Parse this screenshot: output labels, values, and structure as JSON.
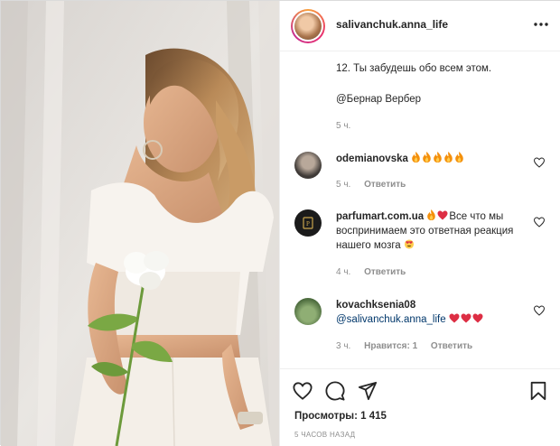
{
  "post": {
    "username": "salivanchuk.anna_life",
    "more_label": "···"
  },
  "caption": {
    "line1": "12. Ты забудешь обо всем этом.",
    "line2": "@Бернар Вербер",
    "time": "5 ч."
  },
  "comments": [
    {
      "username": "odemianovska",
      "text": "",
      "emoji": [
        "fire",
        "fire",
        "fire",
        "fire",
        "fire"
      ],
      "time": "5 ч.",
      "reply": "Ответить"
    },
    {
      "username": "parfumart.com.ua",
      "text_before": "",
      "emoji_inline": [
        "fire",
        "heart"
      ],
      "text": "Все что мы воспринимаем это ответная реакция нашего мозга",
      "emoji_end": "heart-eyes",
      "time": "4 ч.",
      "reply": "Ответить"
    },
    {
      "username": "kovachksenia08",
      "mention": "@salivanchuk.anna_life",
      "emoji": [
        "heart",
        "heart",
        "heart"
      ],
      "time": "3 ч.",
      "likes": "Нравится: 1",
      "reply": "Ответить"
    }
  ],
  "footer": {
    "views": "Просмотры: 1 415",
    "time_ago": "5 часов назад"
  },
  "icons": {
    "like": "heart-outline-icon",
    "comment": "comment-icon",
    "share": "share-icon",
    "save": "bookmark-icon",
    "more": "more-horizontal-icon"
  },
  "colors": {
    "text": "#262626",
    "muted": "#8e8e8e",
    "mention": "#00376b",
    "heart": "#ed4956",
    "fire": "#f4900c"
  }
}
